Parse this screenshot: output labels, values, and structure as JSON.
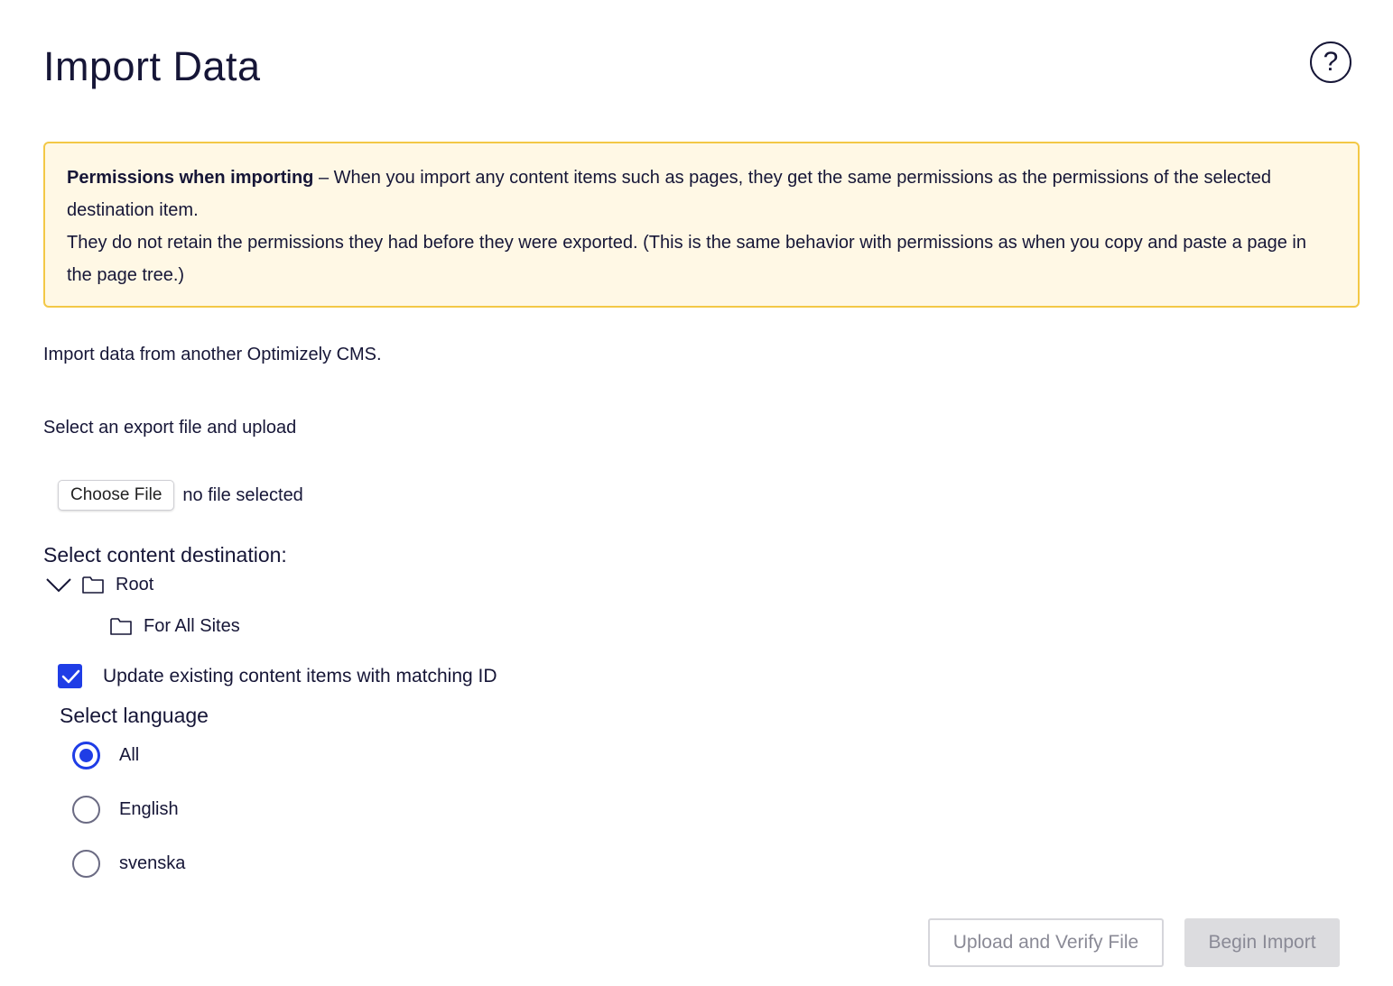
{
  "page": {
    "title": "Import Data"
  },
  "help": {
    "label": "?"
  },
  "notice": {
    "heading": "Permissions when importing",
    "separator": " – ",
    "body1": "When you import any content items such as pages, they get the same permissions as the permissions of the selected destination item.",
    "body2": "They do not retain the permissions they had before they were exported. (This is the same behavior with permissions as when you copy and paste a page in the page tree.)",
    "colors": {
      "background": "#fff8e5",
      "border": "#f3c846"
    }
  },
  "intro": "Import data from another Optimizely CMS.",
  "upload": {
    "label": "Select an export file and upload",
    "choose_button": "Choose File",
    "file_status": "no file selected"
  },
  "destination": {
    "label": "Select content destination:",
    "tree": {
      "root": {
        "label": "Root",
        "expanded": true,
        "icon": "folder-icon"
      },
      "children": [
        {
          "label": "For All Sites",
          "icon": "folder-icon"
        }
      ]
    }
  },
  "options": {
    "update_existing": {
      "label": "Update existing content items with matching ID",
      "checked": true
    }
  },
  "language": {
    "label": "Select language",
    "options": [
      {
        "label": "All",
        "selected": true
      },
      {
        "label": "English",
        "selected": false
      },
      {
        "label": "svenska",
        "selected": false
      }
    ]
  },
  "actions": {
    "upload_verify": "Upload and Verify File",
    "begin_import": "Begin Import"
  },
  "colors": {
    "text": "#161637",
    "accent": "#1f3de6",
    "disabled_text": "#8a8a96"
  }
}
